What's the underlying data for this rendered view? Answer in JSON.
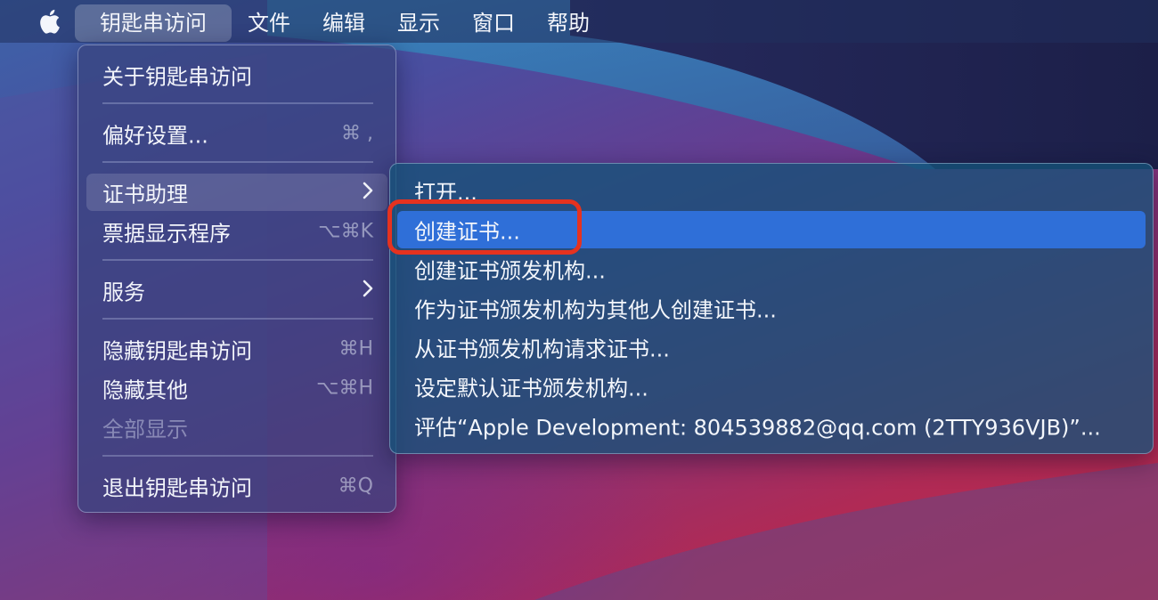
{
  "menubar": {
    "apple_icon": "apple-logo-icon",
    "items": [
      {
        "label": "钥匙串访问",
        "active": true
      },
      {
        "label": "文件"
      },
      {
        "label": "编辑"
      },
      {
        "label": "显示"
      },
      {
        "label": "窗口"
      },
      {
        "label": "帮助"
      }
    ]
  },
  "main_menu": {
    "items": [
      {
        "label": "关于钥匙串访问"
      },
      {
        "label": "偏好设置...",
        "shortcut": "⌘ ,"
      },
      {
        "label": "证书助理",
        "submenu_icon": "chevron-right-icon",
        "highlighted": true
      },
      {
        "label": "票据显示程序",
        "shortcut": "⌥⌘K"
      },
      {
        "label": "服务",
        "submenu_icon": "chevron-right-icon"
      },
      {
        "label": "隐藏钥匙串访问",
        "shortcut": "⌘H"
      },
      {
        "label": "隐藏其他",
        "shortcut": "⌥⌘H"
      },
      {
        "label": "全部显示",
        "disabled": true
      },
      {
        "label": "退出钥匙串访问",
        "shortcut": "⌘Q"
      }
    ]
  },
  "sub_menu": {
    "items": [
      {
        "label": "打开..."
      },
      {
        "label": "创建证书...",
        "selected": true
      },
      {
        "label": "创建证书颁发机构..."
      },
      {
        "label": "作为证书颁发机构为其他人创建证书..."
      },
      {
        "label": "从证书颁发机构请求证书..."
      },
      {
        "label": "设定默认证书颁发机构..."
      },
      {
        "label": "评估“Apple Development: 804539882@qq.com (2TTY936VJB)”..."
      }
    ]
  },
  "colors": {
    "selection": "#2f6fd8",
    "annotation_box": "#e5321f"
  }
}
